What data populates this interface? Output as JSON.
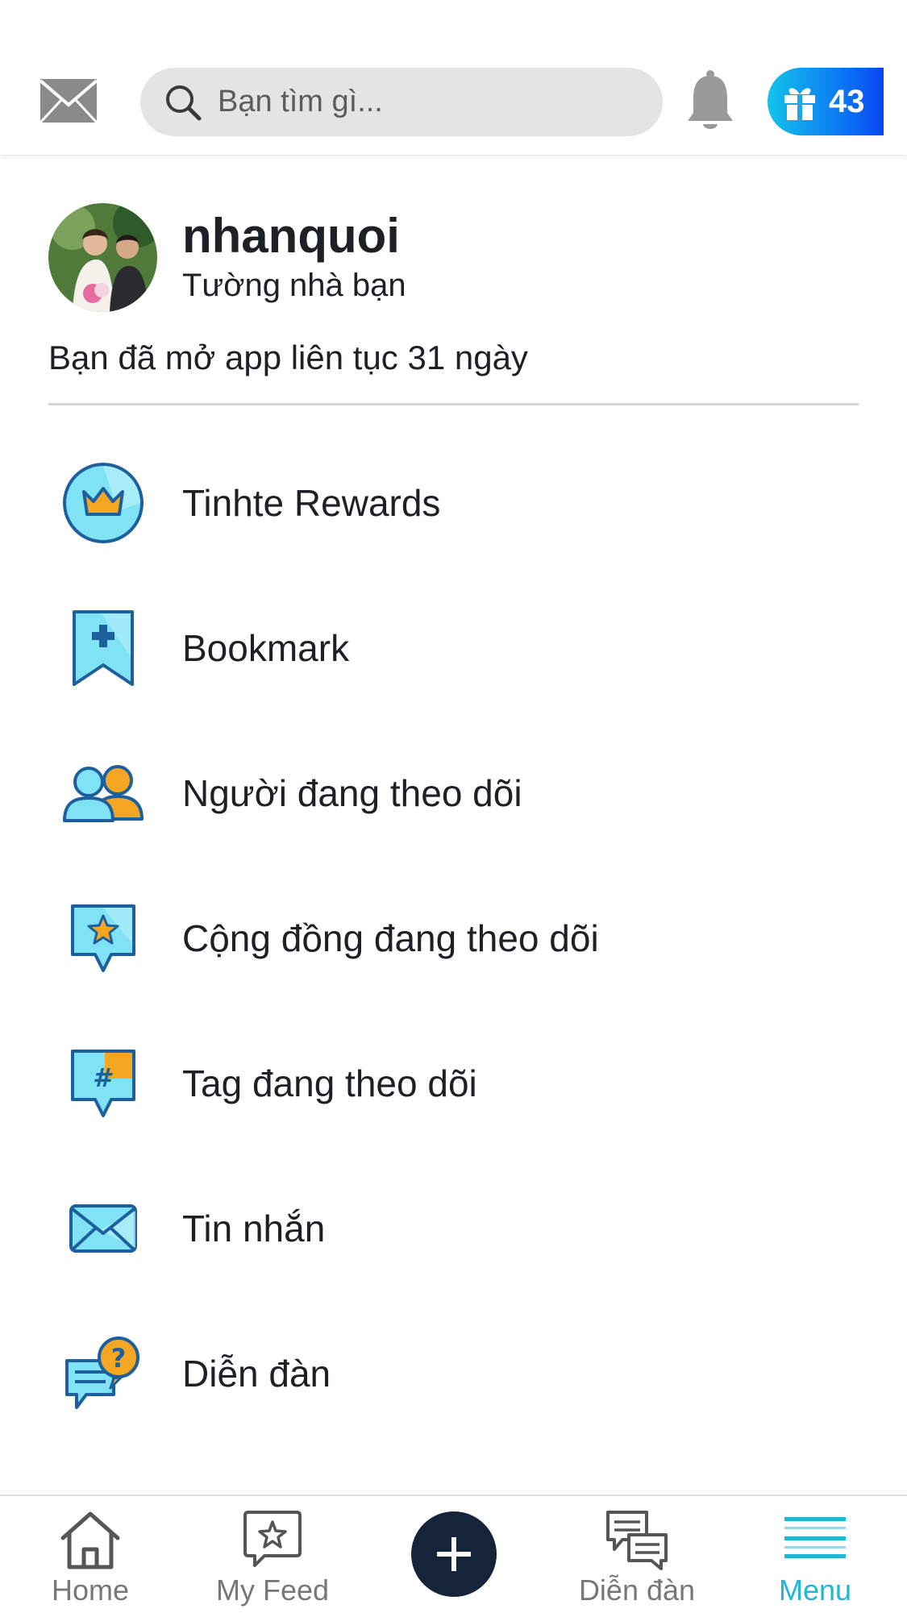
{
  "header": {
    "search_placeholder": "Bạn tìm gì...",
    "gift_count": "43"
  },
  "profile": {
    "username": "nhanquoi",
    "wall_link": "Tường nhà bạn",
    "streak_text": "Bạn đã mở app liên tục 31 ngày"
  },
  "menu": {
    "items": [
      {
        "label": "Tinhte Rewards",
        "icon": "crown-icon"
      },
      {
        "label": "Bookmark",
        "icon": "bookmark-plus-icon"
      },
      {
        "label": "Người đang theo dõi",
        "icon": "people-icon"
      },
      {
        "label": "Cộng đồng đang theo dõi",
        "icon": "star-chat-icon"
      },
      {
        "label": "Tag đang theo dõi",
        "icon": "hashtag-chat-icon"
      },
      {
        "label": "Tin nhắn",
        "icon": "envelope-icon"
      },
      {
        "label": "Diễn đàn",
        "icon": "forum-question-icon"
      }
    ]
  },
  "bottom_nav": {
    "home": "Home",
    "my_feed": "My Feed",
    "forum": "Diễn đàn",
    "menu": "Menu",
    "active": "menu"
  },
  "colors": {
    "accent": "#1fb6d8",
    "navy": "#16243a",
    "icon_fill": "#7fe3f5",
    "icon_stroke": "#1e5f9e",
    "orange": "#f5a623"
  }
}
